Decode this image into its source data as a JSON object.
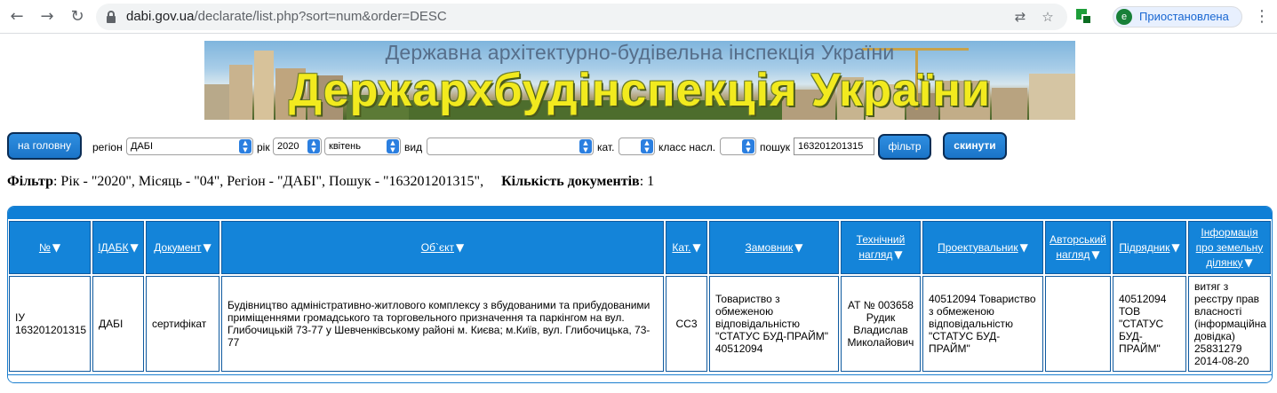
{
  "browser": {
    "url_host": "dabi.gov.ua",
    "url_path": "/declarate/list.php?sort=num&order=DESC",
    "profile_initial": "e",
    "profile_label": "Приостановлена"
  },
  "banner": {
    "subtitle": "Державна архітектурно-будівельна інспекція України",
    "title": "Держархбудінспекція України"
  },
  "filters": {
    "home_button": "на головну",
    "region_label": "регіон",
    "region_value": "ДАБІ",
    "year_label": "рік",
    "year_value": "2020",
    "month_value": "квітень",
    "type_label": "вид",
    "type_value": "",
    "cat_label": "кат.",
    "cat_value": "",
    "class_label": "класс насл.",
    "class_value": "",
    "search_label": "пошук",
    "search_value": "163201201315",
    "filter_button": "фільтр",
    "reset_button": "скинути"
  },
  "summary": {
    "filter_label": "Фільтр",
    "filter_text": ": Рік - \"2020\", Місяць - \"04\", Регіон - \"ДАБІ\", Пошук - \"163201201315\",",
    "count_label": "Кількість документів",
    "count_value": ": 1"
  },
  "table": {
    "headers": [
      "№",
      "ІДАБК",
      "Документ",
      "Об`єкт",
      "Кат.",
      "Замовник",
      [
        "Технічний",
        "нагляд"
      ],
      "Проектувальник",
      [
        "Авторський",
        "нагляд"
      ],
      "Підрядник",
      [
        "Інформація",
        "про земельну",
        "ділянку"
      ]
    ],
    "row": {
      "num": "ІУ 163201201315",
      "idabk": "ДАБІ",
      "doc": "сертифікат",
      "object": "Будівництво адміністративно-житлового комплексу з вбудованими та прибудованими приміщеннями громадського та торговельного призначення та паркінгом на вул. Глибочицькій 73-77 у Шевченківському районі м. Києва; м.Київ, вул. Глибочицька, 73-77",
      "cat": "СС3",
      "customer": "Товариство з обмеженою відповідальністю \"СТАТУС БУД-ПРАЙМ\" 40512094",
      "tech_supervision": "АТ № 003658 Рудик Владислав Миколайович",
      "designer": "40512094 Товариство з обмеженою відповідальністю \"СТАТУС БУД-ПРАЙМ\"",
      "author_supervision": "",
      "contractor": "40512094 ТОВ \"СТАТУС БУД-ПРАЙМ\"",
      "land_info": "витяг з реєстру прав власності (інформаційна довідка) 25831279 2014-08-20"
    }
  },
  "icons": {
    "back": "arrow-left-icon",
    "forward": "arrow-right-icon",
    "reload": "reload-icon",
    "lock": "lock-icon",
    "translate": "translate-icon",
    "star": "star-icon",
    "extension": "extension-icon",
    "menu": "kebab-menu-icon",
    "sort": "sort-triangle-icon",
    "dropdown": "dropdown-arrow-icon"
  },
  "colors": {
    "accent": "#1484d9",
    "button": "#1a74c8",
    "banner_text": "#f2ea1e"
  }
}
